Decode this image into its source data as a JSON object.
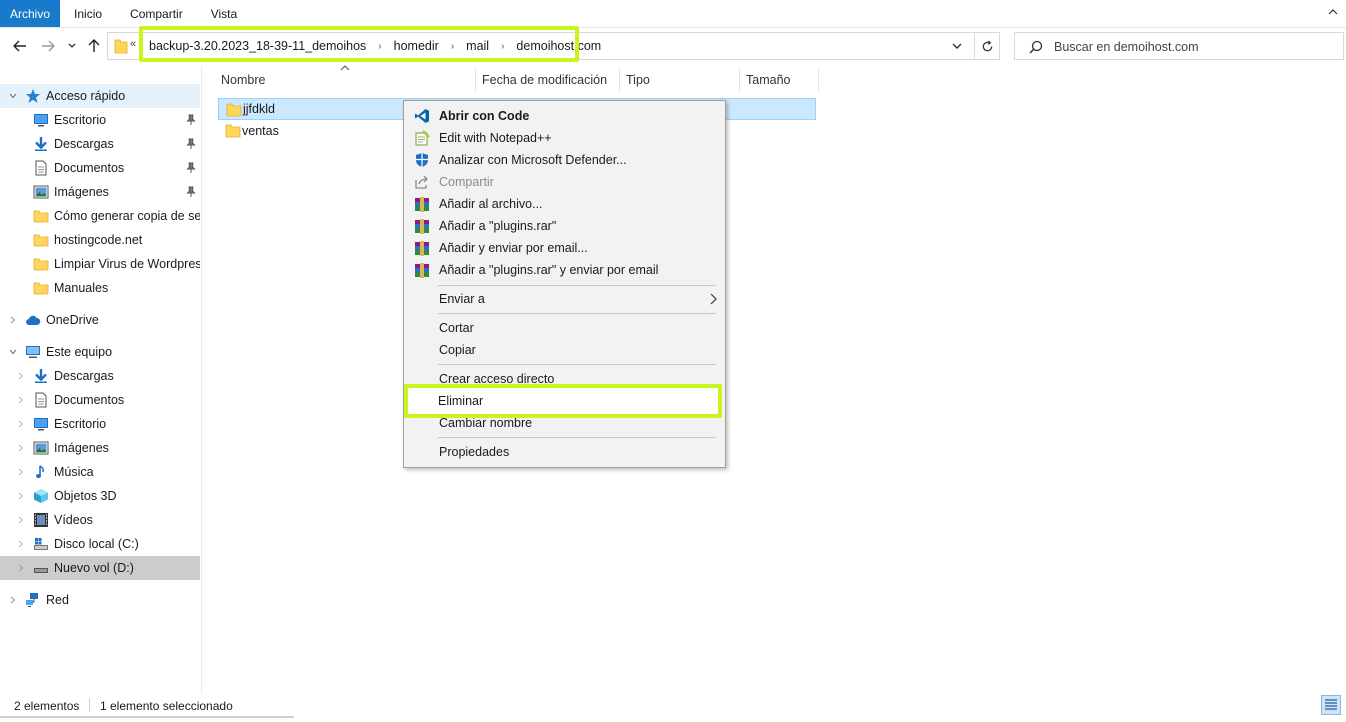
{
  "ribbon": {
    "tabs": [
      "Archivo",
      "Inicio",
      "Compartir",
      "Vista"
    ]
  },
  "address": {
    "overflow": "«",
    "crumbs": [
      "backup-3.20.2023_18-39-11_demoihos",
      "homedir",
      "mail",
      "demoihost.com"
    ]
  },
  "search": {
    "placeholder": "Buscar en demoihost.com"
  },
  "sidebar": {
    "quick_access": "Acceso rápido",
    "quick_items": [
      "Escritorio",
      "Descargas",
      "Documentos",
      "Imágenes",
      "Cómo generar copia de seg",
      "hostingcode.net",
      "Limpiar Virus de Wordpress",
      "Manuales"
    ],
    "onedrive": "OneDrive",
    "this_pc": "Este equipo",
    "pc_items": [
      "Descargas",
      "Documentos",
      "Escritorio",
      "Imágenes",
      "Música",
      "Objetos 3D",
      "Vídeos",
      "Disco local (C:)",
      "Nuevo vol (D:)"
    ],
    "network": "Red"
  },
  "columns": {
    "name": "Nombre",
    "modified": "Fecha de modificación",
    "type": "Tipo",
    "size": "Tamaño"
  },
  "files": [
    {
      "name": "jjfdkld",
      "selected": true
    },
    {
      "name": "ventas",
      "selected": false
    }
  ],
  "context_menu": {
    "items": [
      {
        "label": "Abrir con Code",
        "icon": "vscode-icon"
      },
      {
        "label": "Edit with Notepad++",
        "icon": "notepadpp-icon"
      },
      {
        "label": "Analizar con Microsoft Defender...",
        "icon": "defender-icon"
      },
      {
        "label": "Compartir",
        "icon": "share-icon"
      },
      {
        "label": "Añadir al archivo...",
        "icon": "winrar-icon"
      },
      {
        "label": "Añadir a \"plugins.rar\"",
        "icon": "winrar-icon"
      },
      {
        "label": "Añadir y enviar por email...",
        "icon": "winrar-icon"
      },
      {
        "label": "Añadir a \"plugins.rar\" y enviar por email",
        "icon": "winrar-icon"
      },
      {
        "label": "Enviar a"
      },
      {
        "label": "Cortar"
      },
      {
        "label": "Copiar"
      },
      {
        "label": "Crear acceso directo"
      },
      {
        "label": "Eliminar"
      },
      {
        "label": "Cambiar nombre"
      },
      {
        "label": "Propiedades"
      }
    ]
  },
  "status": {
    "count": "2 elementos",
    "selection": "1 elemento seleccionado"
  },
  "colors": {
    "accent": "#1979ca",
    "highlight": "#c8f51e",
    "selection": "#cce8ff"
  }
}
